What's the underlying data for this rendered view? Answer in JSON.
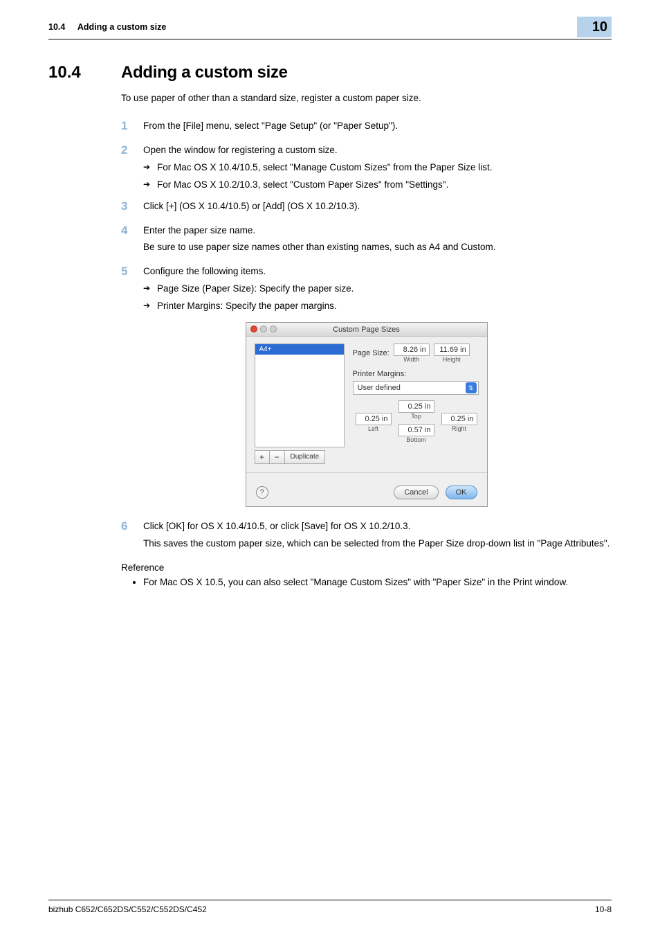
{
  "header": {
    "section_no": "10.4",
    "section_title": "Adding a custom size",
    "chapter_badge": "10"
  },
  "heading": {
    "number": "10.4",
    "title": "Adding a custom size"
  },
  "intro": "To use paper of other than a standard size, register a custom paper size.",
  "steps": [
    {
      "n": "1",
      "lines": [
        "From the [File] menu, select \"Page Setup\" (or \"Paper Setup\")."
      ]
    },
    {
      "n": "2",
      "lines": [
        "Open the window for registering a custom size."
      ],
      "subs": [
        "For Mac OS X 10.4/10.5, select \"Manage Custom Sizes\" from the Paper Size list.",
        "For Mac OS X 10.2/10.3, select \"Custom Paper Sizes\" from \"Settings\"."
      ]
    },
    {
      "n": "3",
      "lines": [
        "Click [+] (OS X 10.4/10.5) or [Add] (OS X 10.2/10.3)."
      ]
    },
    {
      "n": "4",
      "lines": [
        "Enter the paper size name.",
        "Be sure to use paper size names other than existing names, such as A4 and Custom."
      ]
    },
    {
      "n": "5",
      "lines": [
        "Configure the following items."
      ],
      "subs": [
        "Page Size (Paper Size): Specify the paper size.",
        "Printer Margins: Specify the paper margins."
      ]
    }
  ],
  "dialog": {
    "title": "Custom Page Sizes",
    "list_selected": "A4+",
    "page_size_label": "Page Size:",
    "width_value": "8.26 in",
    "width_label": "Width",
    "height_value": "11.69 in",
    "height_label": "Height",
    "margins_label": "Printer Margins:",
    "margins_dropdown": "User defined",
    "top_value": "0.25 in",
    "top_label": "Top",
    "left_value": "0.25 in",
    "left_label": "Left",
    "right_value": "0.25 in",
    "right_label": "Right",
    "bottom_value": "0.57 in",
    "bottom_label": "Bottom",
    "plus": "+",
    "minus": "−",
    "duplicate": "Duplicate",
    "help": "?",
    "cancel": "Cancel",
    "ok": "OK"
  },
  "step6": {
    "n": "6",
    "lines": [
      "Click [OK] for OS X 10.4/10.5, or click [Save] for OS X 10.2/10.3.",
      "This saves the custom paper size, which can be selected from the Paper Size drop-down list in \"Page Attributes\"."
    ]
  },
  "reference": {
    "heading": "Reference",
    "bullet": "For Mac OS X 10.5, you can also select \"Manage Custom Sizes\" with \"Paper Size\" in the Print window."
  },
  "footer": {
    "left": "bizhub C652/C652DS/C552/C552DS/C452",
    "right": "10-8"
  }
}
